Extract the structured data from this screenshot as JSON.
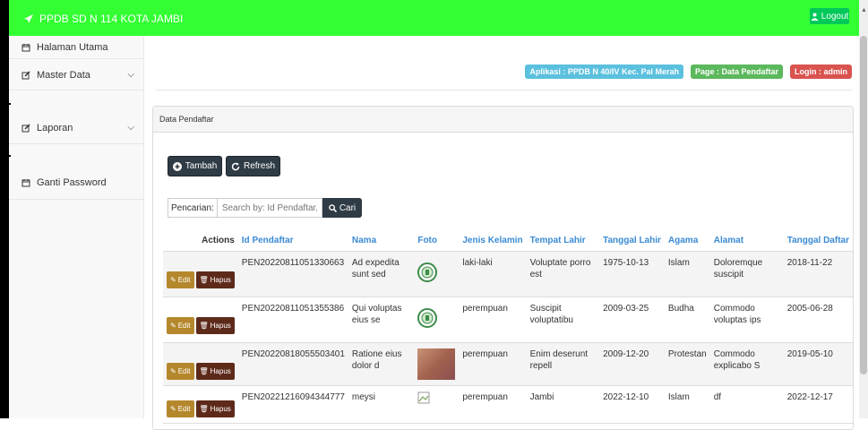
{
  "app": {
    "title": "PPDB SD N 114 KOTA JAMBI",
    "logout_label": "Logout"
  },
  "sidebar": {
    "items": [
      {
        "label": "Halaman Utama",
        "icon": "calendar-icon"
      },
      {
        "label": "Master Data",
        "icon": "edit-icon",
        "has_chevron": true
      },
      {
        "label": "Laporan",
        "icon": "edit-icon",
        "has_chevron": true
      },
      {
        "label": "Ganti Password",
        "icon": "calendar-icon"
      }
    ]
  },
  "badges": {
    "app": "Aplikasi : PPDB N 40/IV Kec. Pal Merah",
    "page": "Page : Data Pendaftar",
    "login": "Login : admin"
  },
  "colors": {
    "topbar": "#33ff33",
    "badge_app": "#5bc0de",
    "badge_page": "#5cb85c",
    "badge_login": "#d9534f"
  },
  "panel": {
    "title": "Data Pendaftar",
    "add_label": "Tambah",
    "refresh_label": "Refresh",
    "search_label": "Pencarian:",
    "search_placeholder": "Search by: Id Pendaftar, Na",
    "search_button": "Cari"
  },
  "table": {
    "headers": [
      "Actions",
      "Id Pendaftar",
      "Nama",
      "Foto",
      "Jenis Kelamin",
      "Tempat Lahir",
      "Tanggal Lahir",
      "Agama",
      "Alamat",
      "Tanggal Daftar"
    ],
    "edit_label": "Edit",
    "delete_label": "Hapus",
    "rows": [
      {
        "id": "PEN20220811051330663",
        "nama": "Ad expedita sunt sed",
        "foto": "logo",
        "jk": "laki-laki",
        "tempat": "Voluptate porro est",
        "tgl_lahir": "1975-10-13",
        "agama": "Islam",
        "alamat": "Doloremque suscipit",
        "tgl_daftar": "2018-11-22"
      },
      {
        "id": "PEN20220811051355386",
        "nama": "Qui voluptas eius se",
        "foto": "logo",
        "jk": "perempuan",
        "tempat": "Suscipit voluptatibu",
        "tgl_lahir": "2009-03-25",
        "agama": "Budha",
        "alamat": "Commodo voluptas ips",
        "tgl_daftar": "2005-06-28"
      },
      {
        "id": "PEN20220818055503401",
        "nama": "Ratione eius dolor d",
        "foto": "photo",
        "jk": "perempuan",
        "tempat": "Enim deserunt repell",
        "tgl_lahir": "2009-12-20",
        "agama": "Protestan",
        "alamat": "Commodo explicabo S",
        "tgl_daftar": "2019-05-10"
      },
      {
        "id": "PEN20221216094344777",
        "nama": "meysi",
        "foto": "broken",
        "jk": "perempuan",
        "tempat": "Jambi",
        "tgl_lahir": "2022-12-10",
        "agama": "Islam",
        "alamat": "df",
        "tgl_daftar": "2022-12-17"
      }
    ]
  }
}
